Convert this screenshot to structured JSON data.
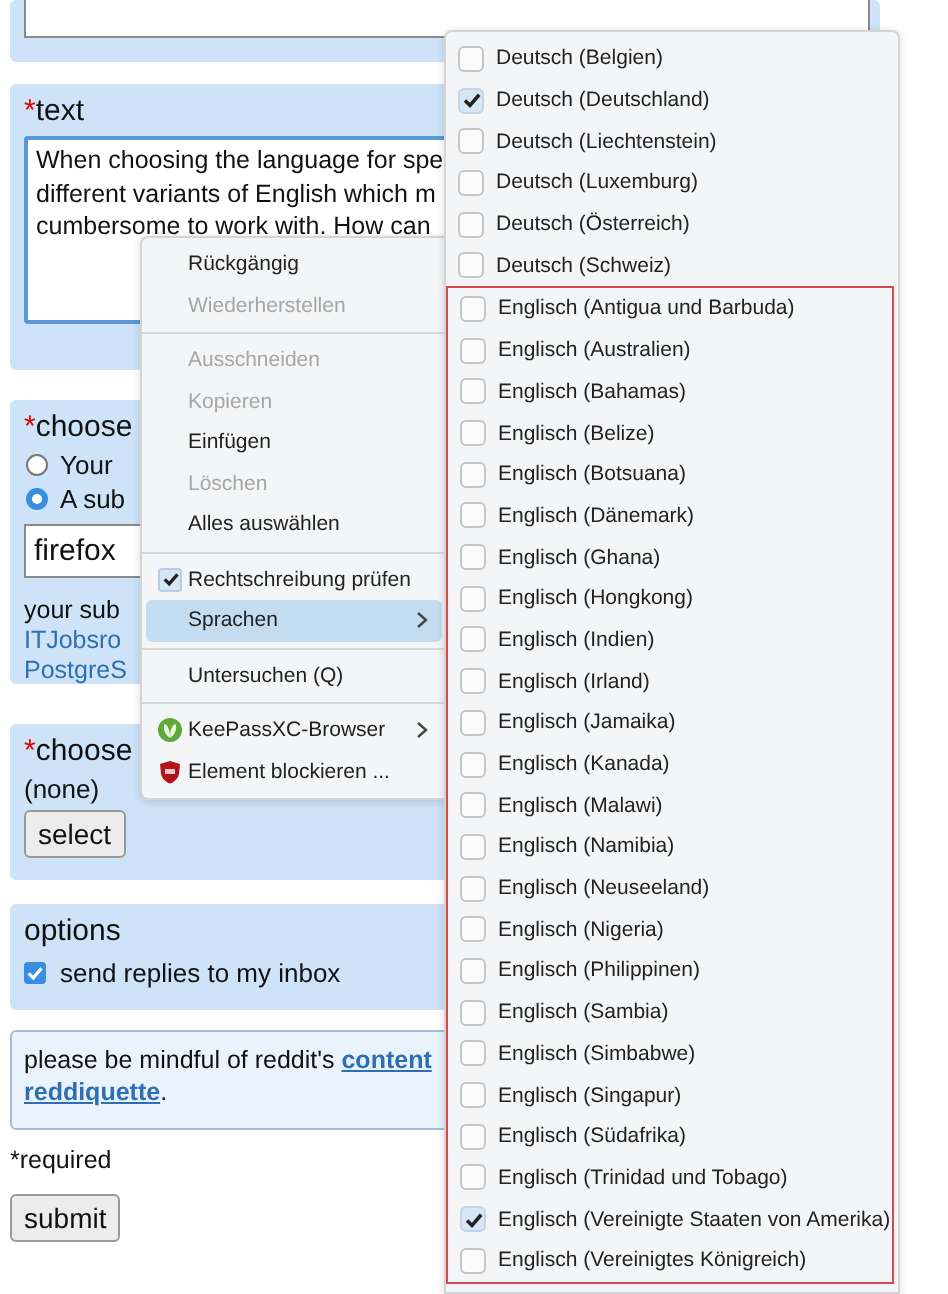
{
  "form": {
    "text_field": {
      "required_mark": "*",
      "label": "text",
      "value": "When choosing the language for spe\ndifferent variants of English which m\ncumbersome to work with. How can"
    },
    "subreddit": {
      "required_mark": "*",
      "label": "choose",
      "options": [
        {
          "label": "Your",
          "selected": false
        },
        {
          "label": "A sub",
          "selected": true
        }
      ],
      "input_value": "firefox",
      "hint": "your sub",
      "links": [
        "ITJobsro",
        "PostgreS"
      ]
    },
    "flair": {
      "required_mark": "*",
      "label": "choose",
      "value": "(none)",
      "button": "select"
    },
    "options": {
      "title": "options",
      "checkboxes": [
        {
          "label": "send replies to my inbox",
          "checked": true
        }
      ]
    },
    "notice": {
      "lines": [
        [
          {
            "kind": "text",
            "text": "please be mindful of reddit's "
          },
          {
            "kind": "link",
            "text": "content"
          }
        ],
        [
          {
            "kind": "link",
            "text": "reddiquette"
          },
          {
            "kind": "text",
            "text": "."
          }
        ]
      ]
    },
    "required_note": "*required",
    "submit": "submit"
  },
  "context_menu": {
    "items": [
      {
        "kind": "command",
        "label": "Rückgängig",
        "disabled": false,
        "highlighted": false
      },
      {
        "kind": "command",
        "label": "Wiederherstellen",
        "disabled": true,
        "highlighted": false
      },
      {
        "kind": "separator"
      },
      {
        "kind": "command",
        "label": "Ausschneiden",
        "disabled": true,
        "highlighted": false
      },
      {
        "kind": "command",
        "label": "Kopieren",
        "disabled": true,
        "highlighted": false
      },
      {
        "kind": "command",
        "label": "Einfügen",
        "disabled": false,
        "highlighted": false
      },
      {
        "kind": "command",
        "label": "Löschen",
        "disabled": true,
        "highlighted": false
      },
      {
        "kind": "command",
        "label": "Alles auswählen",
        "disabled": false,
        "highlighted": false
      },
      {
        "kind": "separator"
      },
      {
        "kind": "check",
        "label": "Rechtschreibung prüfen",
        "checked": true,
        "disabled": false,
        "highlighted": false
      },
      {
        "kind": "submenu",
        "label": "Sprachen",
        "disabled": false,
        "highlighted": true
      },
      {
        "kind": "separator"
      },
      {
        "kind": "command",
        "label": "Untersuchen (Q)",
        "disabled": false,
        "highlighted": false
      },
      {
        "kind": "separator"
      },
      {
        "kind": "extension-submenu",
        "label": "KeePassXC-Browser",
        "color": "#5fa83a",
        "disabled": false,
        "highlighted": false
      },
      {
        "kind": "extension",
        "label": "Element blockieren ...",
        "color": "#b5121b",
        "disabled": false,
        "highlighted": false
      }
    ]
  },
  "languages_menu": {
    "items": [
      {
        "label": "Deutsch (Belgien)",
        "checked": false
      },
      {
        "label": "Deutsch (Deutschland)",
        "checked": true
      },
      {
        "label": "Deutsch (Liechtenstein)",
        "checked": false
      },
      {
        "label": "Deutsch (Luxemburg)",
        "checked": false
      },
      {
        "label": "Deutsch (Österreich)",
        "checked": false
      },
      {
        "label": "Deutsch (Schweiz)",
        "checked": false
      }
    ],
    "outlined_group": {
      "items": [
        {
          "label": "Englisch (Antigua und Barbuda)",
          "checked": false
        },
        {
          "label": "Englisch (Australien)",
          "checked": false
        },
        {
          "label": "Englisch (Bahamas)",
          "checked": false
        },
        {
          "label": "Englisch (Belize)",
          "checked": false
        },
        {
          "label": "Englisch (Botsuana)",
          "checked": false
        },
        {
          "label": "Englisch (Dänemark)",
          "checked": false
        },
        {
          "label": "Englisch (Ghana)",
          "checked": false
        },
        {
          "label": "Englisch (Hongkong)",
          "checked": false
        },
        {
          "label": "Englisch (Indien)",
          "checked": false
        },
        {
          "label": "Englisch (Irland)",
          "checked": false
        },
        {
          "label": "Englisch (Jamaika)",
          "checked": false
        },
        {
          "label": "Englisch (Kanada)",
          "checked": false
        },
        {
          "label": "Englisch (Malawi)",
          "checked": false
        },
        {
          "label": "Englisch (Namibia)",
          "checked": false
        },
        {
          "label": "Englisch (Neuseeland)",
          "checked": false
        },
        {
          "label": "Englisch (Nigeria)",
          "checked": false
        },
        {
          "label": "Englisch (Philippinen)",
          "checked": false
        },
        {
          "label": "Englisch (Sambia)",
          "checked": false
        },
        {
          "label": "Englisch (Simbabwe)",
          "checked": false
        },
        {
          "label": "Englisch (Singapur)",
          "checked": false
        },
        {
          "label": "Englisch (Südafrika)",
          "checked": false
        },
        {
          "label": "Englisch (Trinidad und Tobago)",
          "checked": false
        },
        {
          "label": "Englisch (Vereinigte Staaten von Amerika)",
          "checked": true
        },
        {
          "label": "Englisch (Vereinigtes Königreich)",
          "checked": false
        }
      ]
    }
  }
}
